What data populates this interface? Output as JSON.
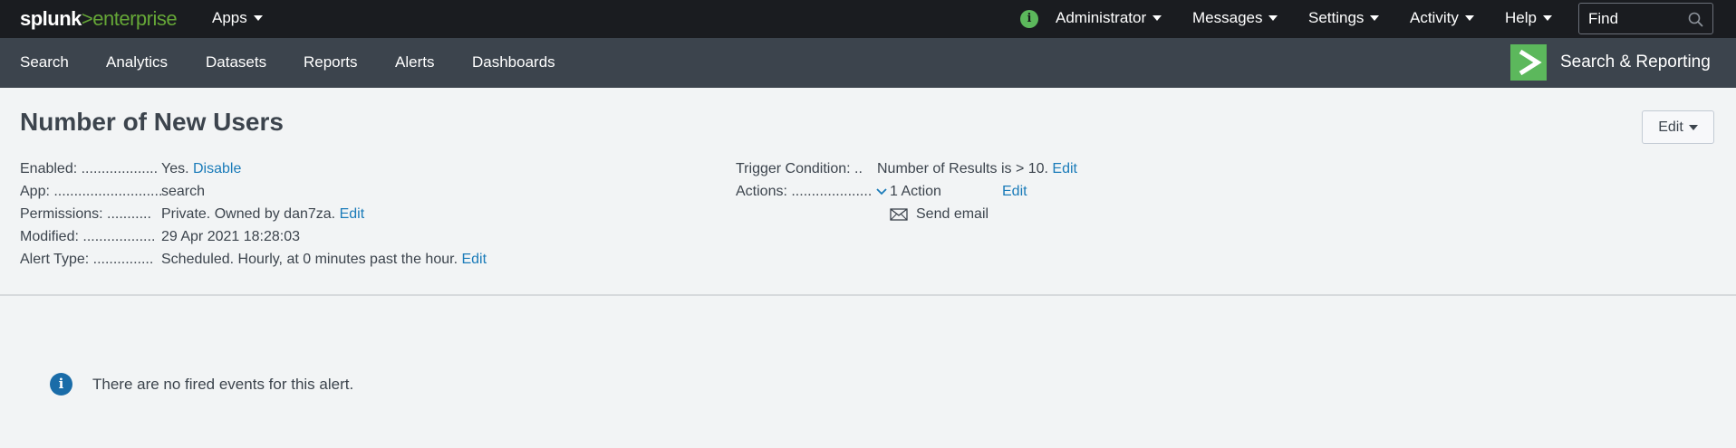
{
  "header": {
    "logo_left": "splunk",
    "logo_gt": ">",
    "logo_right": "enterprise",
    "apps": "Apps",
    "user": "Administrator",
    "messages": "Messages",
    "settings": "Settings",
    "activity": "Activity",
    "help": "Help",
    "find_placeholder": "Find"
  },
  "appbar": {
    "items": [
      "Search",
      "Analytics",
      "Datasets",
      "Reports",
      "Alerts",
      "Dashboards"
    ],
    "app_name": "Search & Reporting"
  },
  "alert": {
    "title": "Number of New Users",
    "edit_button": "Edit",
    "enabled_label": "Enabled: ...................",
    "enabled_value": "Yes.",
    "disable_link": "Disable",
    "app_label": "App: ...........................",
    "app_value": "search",
    "permissions_label": "Permissions: ...........",
    "permissions_value": "Private. Owned by dan7za.",
    "permissions_edit": "Edit",
    "modified_label": "Modified: ..................",
    "modified_value": "29 Apr 2021 18:28:03",
    "type_label": "Alert Type: ...............",
    "type_value": "Scheduled. Hourly, at 0 minutes past the hour.",
    "type_edit": "Edit",
    "trigger_label": "Trigger Condition: ..",
    "trigger_value": "Number of Results is > 10.",
    "trigger_edit": "Edit",
    "actions_label": "Actions: ....................",
    "actions_value": "1 Action",
    "actions_edit": "Edit",
    "action_item": "Send email"
  },
  "empty_state": {
    "message": "There are no fired events for this alert."
  },
  "colors": {
    "topbar": "#1a1c20",
    "appbar": "#3c444d",
    "accent_green": "#5cb85c",
    "link": "#1a7bb9"
  }
}
